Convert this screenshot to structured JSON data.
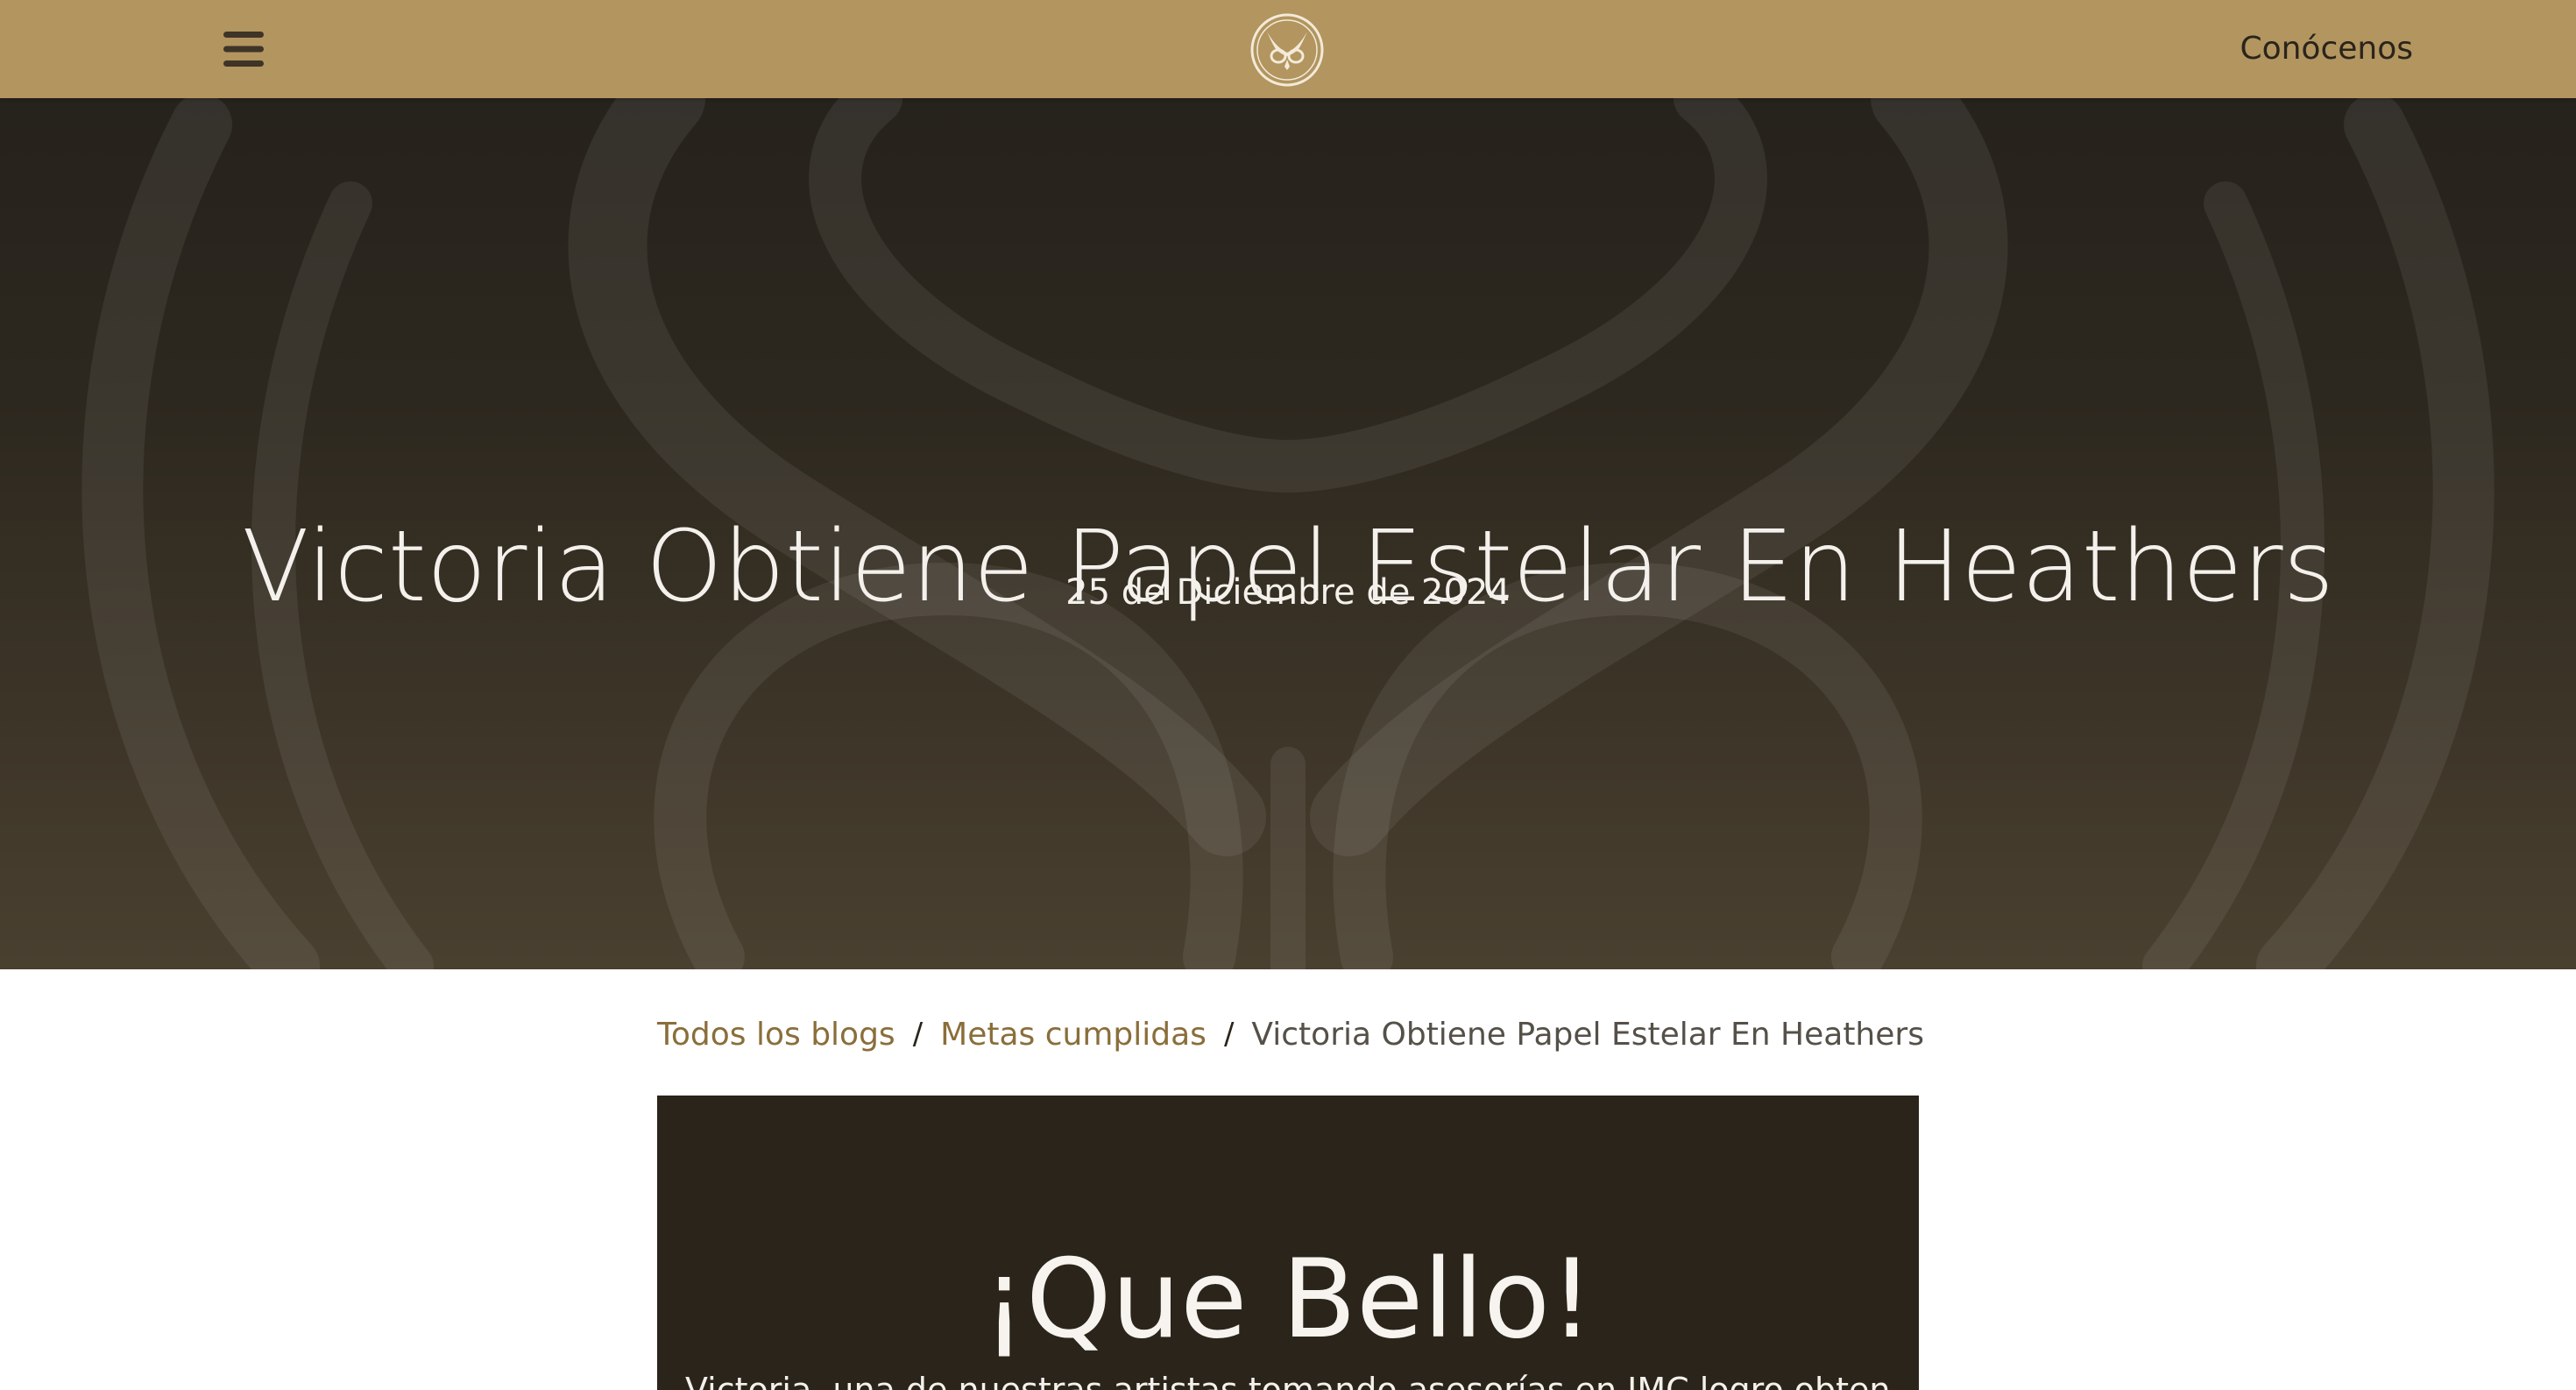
{
  "header": {
    "menu_icon": "hamburger-icon",
    "logo_icon": "owl-logo-icon",
    "nav_link": "Conócenos"
  },
  "hero": {
    "title": "Victoria Obtiene Papel Estelar En Heathers",
    "date": "25 de Diciembre de 2024"
  },
  "breadcrumb": {
    "items": [
      "Todos los blogs",
      "Metas cumplidas"
    ],
    "separator": "/",
    "current": "Victoria Obtiene Papel Estelar En Heathers"
  },
  "article": {
    "heading": "¡Que Bello!",
    "intro": "Victoria, una de nuestras artistas tomando asesorías en IMC logro obtener lo que"
  },
  "colors": {
    "header_bg": "#b2955f",
    "hero_bg": "#2d281f",
    "card_bg": "#2b241a",
    "link": "#8a6e3a"
  }
}
